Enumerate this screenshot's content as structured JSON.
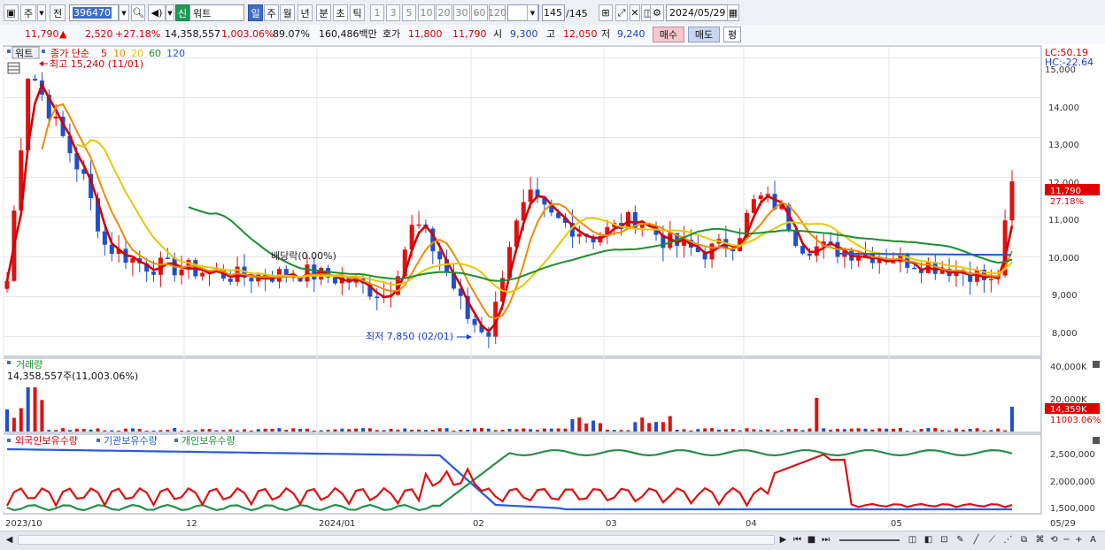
{
  "toolbar": {
    "type_label": "주",
    "prev_label": "전",
    "code_value": "396470",
    "badge_label": "신",
    "name_value": "워트",
    "periods": [
      "일",
      "주",
      "월",
      "년",
      "분",
      "초",
      "틱"
    ],
    "counts": [
      "1",
      "3",
      "5",
      "10",
      "20",
      "30",
      "60",
      "120"
    ],
    "count_value": "145",
    "count_total": "/145",
    "date_value": "2024/05/29"
  },
  "quote": {
    "price": "11,790",
    "up_arrow": "▲",
    "change": "2,520",
    "change_pct": "+27.18%",
    "volume": "14,358,557",
    "vol_ratio": "1,003.06%",
    "rotation": "89.07%",
    "amount": "160,486백만",
    "quote_label": "호가",
    "ask": "11,800",
    "bid": "11,790",
    "open_label": "시",
    "open": "9,300",
    "high_label": "고",
    "high": "12,050",
    "low_label": "저",
    "low": "9,240",
    "buy_label": "매수",
    "sell_label": "매도",
    "eval_label": "평"
  },
  "chart": {
    "stock_tag": "워트",
    "legend_title": "종가 단순",
    "ma_labels": [
      "5",
      "10",
      "20",
      "60",
      "120"
    ],
    "ma_colors": [
      "#d40000",
      "#f08c00",
      "#e6c800",
      "#1a8f2e",
      "#1f5ad6"
    ],
    "max_note": "최고 15,240 (11/01)",
    "min_note": "최저 7,850 (02/01)",
    "dividend_note": "배당락(0.00%)",
    "lc": "LC:50.19",
    "hc": "HC:-22.64",
    "price_ticks": [
      "15,000",
      "14,000",
      "13,000",
      "12,000",
      "11,000",
      "10,000",
      "9,000",
      "8,000"
    ],
    "current_price_tag": "11,790",
    "current_pct_tag": "27.18%",
    "volume_title": "거래량",
    "volume_note": "14,358,557주(11,003.06%)",
    "volume_ticks": [
      "40,000K",
      "20,000K"
    ],
    "volume_tag": "14,359K",
    "volume_tag2": "11003.06%",
    "holding_labels": [
      "외국인보유수량",
      "기관보유수량",
      "개인보유수량"
    ],
    "holding_ticks": [
      "2,500,000",
      "2,000,000",
      "1,500,000"
    ],
    "x_labels": [
      "2023/10",
      "12",
      "2024/01",
      "02",
      "03",
      "04",
      "05",
      "05/29"
    ]
  },
  "chart_data": {
    "type": "line",
    "title": "",
    "series": [
      {
        "name": "종가 단순 5",
        "values": []
      },
      {
        "name": "종가 단순 10",
        "values": []
      },
      {
        "name": "종가 단순 20",
        "values": []
      },
      {
        "name": "종가 단순 60",
        "values": []
      },
      {
        "name": "종가 단순 120",
        "values": []
      }
    ],
    "price_ylim": [
      7500,
      15300
    ],
    "highest": {
      "value": 15240,
      "date": "11/01"
    },
    "lowest": {
      "value": 7850,
      "date": "02/01"
    },
    "last": {
      "close": 11790,
      "open": 9300,
      "high": 12050,
      "low": 9240,
      "volume": 14358557
    },
    "volume_ylim": [
      0,
      40000000
    ],
    "holding_ylim": [
      1400000,
      2700000
    ],
    "xlabel": "",
    "ylabel": ""
  }
}
